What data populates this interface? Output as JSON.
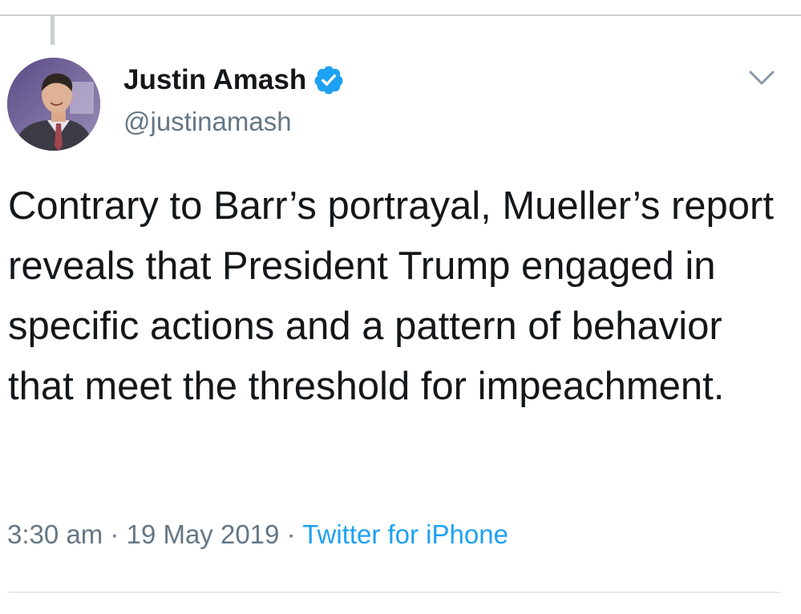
{
  "author": {
    "display_name": "Justin Amash",
    "handle": "@justinamash",
    "verified": true,
    "avatar_icon": "profile-photo"
  },
  "tweet": {
    "text": "Contrary to Barr’s portrayal, Mueller’s report reveals that President Trump engaged in specific actions and a pattern of behavior that meet the threshold for impeachment."
  },
  "meta": {
    "time": "3:30 am",
    "separator": "·",
    "date": "19 May 2019",
    "source": "Twitter for iPhone"
  },
  "icons": {
    "verified": "verified-badge-icon",
    "menu": "chevron-down-icon"
  },
  "colors": {
    "accent": "#1da1f2",
    "secondary_text": "#657786",
    "primary_text": "#14171a",
    "border": "#e6ecf0"
  }
}
